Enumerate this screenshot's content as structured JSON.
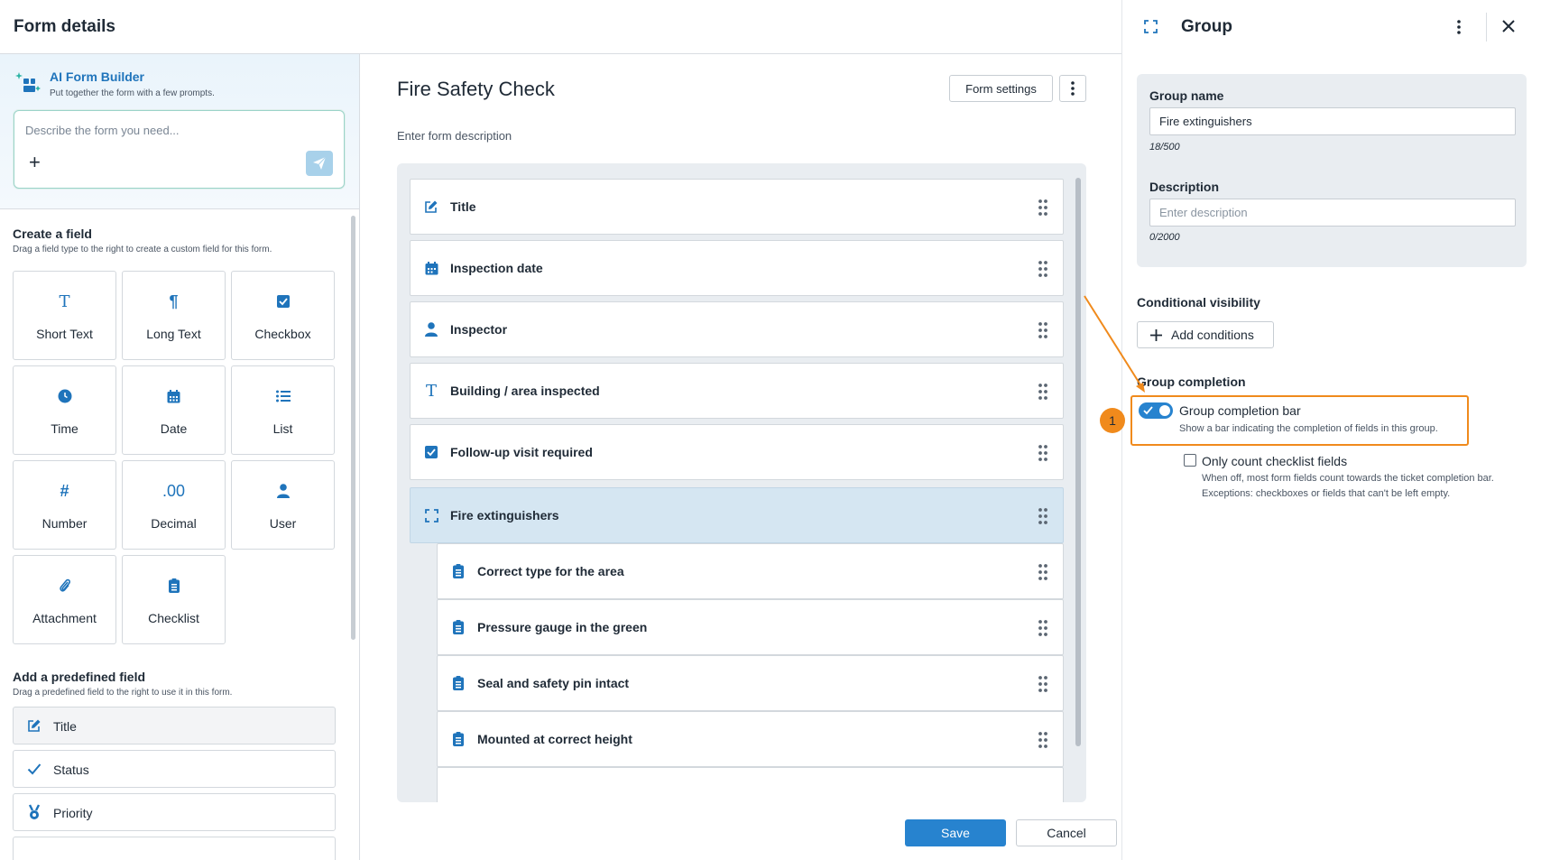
{
  "header": {
    "title": "Form details"
  },
  "ai_builder": {
    "title": "AI Form Builder",
    "subtitle": "Put together the form with a few prompts.",
    "placeholder": "Describe the form you need..."
  },
  "create_field": {
    "title": "Create a field",
    "subtitle": "Drag a field type to the right to create a custom field for this form.",
    "fields": [
      {
        "label": "Short Text",
        "icon": "text-icon",
        "glyph": "T"
      },
      {
        "label": "Long Text",
        "icon": "paragraph-icon",
        "glyph": "¶"
      },
      {
        "label": "Checkbox",
        "icon": "checkbox-icon",
        "glyph": ""
      },
      {
        "label": "Time",
        "icon": "clock-icon",
        "glyph": ""
      },
      {
        "label": "Date",
        "icon": "calendar-icon",
        "glyph": ""
      },
      {
        "label": "List",
        "icon": "list-icon",
        "glyph": ""
      },
      {
        "label": "Number",
        "icon": "hash-icon",
        "glyph": "#"
      },
      {
        "label": "Decimal",
        "icon": "decimal-icon",
        "glyph": ".00"
      },
      {
        "label": "User",
        "icon": "user-icon",
        "glyph": ""
      },
      {
        "label": "Attachment",
        "icon": "paperclip-icon",
        "glyph": ""
      },
      {
        "label": "Checklist",
        "icon": "checklist-icon",
        "glyph": ""
      }
    ]
  },
  "predefined": {
    "title": "Add a predefined field",
    "subtitle": "Drag a predefined field to the right to use it in this form.",
    "items": [
      {
        "label": "Title",
        "icon": "edit-icon"
      },
      {
        "label": "Status",
        "icon": "check-icon"
      },
      {
        "label": "Priority",
        "icon": "priority-icon"
      }
    ]
  },
  "form": {
    "title": "Fire Safety Check",
    "settings_label": "Form settings",
    "description_placeholder": "Enter form description",
    "rows": [
      {
        "label": "Title",
        "icon": "edit-icon"
      },
      {
        "label": "Inspection date",
        "icon": "calendar-icon"
      },
      {
        "label": "Inspector",
        "icon": "user-icon"
      },
      {
        "label": "Building / area inspected",
        "icon": "text-icon"
      },
      {
        "label": "Follow-up visit required",
        "icon": "checkbox-icon"
      },
      {
        "label": "Fire extinguishers",
        "icon": "group-icon"
      },
      {
        "label": "Correct type for the area",
        "icon": "checklist-icon"
      },
      {
        "label": "Pressure gauge in the green",
        "icon": "checklist-icon"
      },
      {
        "label": "Seal and safety pin intact",
        "icon": "checklist-icon"
      },
      {
        "label": "Mounted at correct height",
        "icon": "checklist-icon"
      }
    ],
    "save_label": "Save",
    "cancel_label": "Cancel"
  },
  "panel": {
    "title": "Group",
    "group_name_label": "Group name",
    "group_name_value": "Fire extinguishers",
    "group_name_counter": "18/500",
    "description_label": "Description",
    "description_placeholder": "Enter description",
    "description_counter": "0/2000",
    "conditional_label": "Conditional visibility",
    "add_conditions_label": "Add conditions",
    "completion_label": "Group completion",
    "completion_bar_label": "Group completion bar",
    "completion_bar_desc": "Show a bar indicating the completion of fields in this group.",
    "completion_bar_enabled": true,
    "only_checklist_label": "Only count checklist fields",
    "only_checklist_desc": "When off, most form fields count towards the ticket completion bar. Exceptions: checkboxes or fields that can't be left empty.",
    "only_checklist_checked": false,
    "callout_number": "1"
  },
  "colors": {
    "accent": "#1f74bb",
    "primary_button": "#2783cf",
    "highlight": "#f08a1c"
  }
}
